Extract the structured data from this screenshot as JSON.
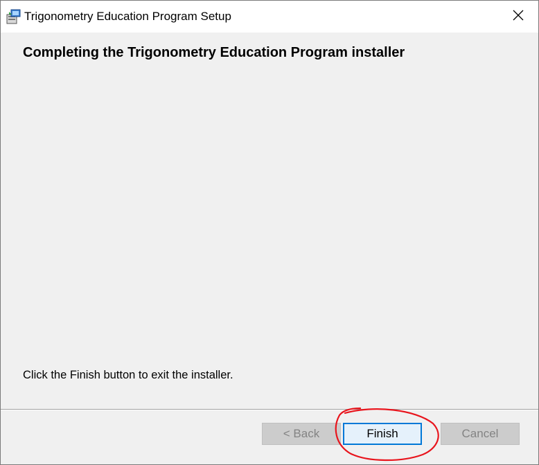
{
  "window": {
    "title": "Trigonometry Education Program Setup",
    "app_icon": "installer-package-icon",
    "close_icon": "close-icon"
  },
  "content": {
    "heading": "Completing the Trigonometry Education Program installer",
    "instruction": "Click the Finish button to exit the installer."
  },
  "buttons": {
    "back_label": "< Back",
    "finish_label": "Finish",
    "cancel_label": "Cancel"
  },
  "colors": {
    "annotation_circle": "#e8141c",
    "focus_border": "#0078d7",
    "dialog_background": "#f0f0f0"
  }
}
